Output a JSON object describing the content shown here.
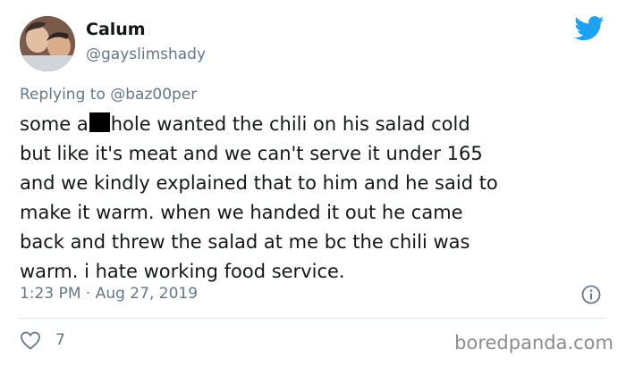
{
  "author": {
    "name": "Calum",
    "handle": "@gayslimshady",
    "avatar_icon": "avatar-photo"
  },
  "reply": {
    "prefix": "Replying to",
    "mention": "@baz00per"
  },
  "tweet": {
    "line1_before": "some a",
    "line1_after": "hole wanted the chili on his salad cold",
    "line2": "but like it's meat and we can't serve it under 165",
    "line3": "and we kindly explained that to him and he said to",
    "line4": "make it warm. when we handed it out he came",
    "line5": "back and threw the salad at me bc the chili was",
    "line6": "warm. i hate working food service."
  },
  "meta": {
    "timestamp": "1:23 PM · Aug 27, 2019",
    "likes": "7"
  },
  "icons": {
    "brand": "twitter-bird-icon",
    "info": "info-icon",
    "like": "heart-icon"
  },
  "colors": {
    "twitter_blue": "#1da1f2",
    "secondary_text": "#657786",
    "primary_text": "#14171a"
  },
  "watermark": "boredpanda.com"
}
